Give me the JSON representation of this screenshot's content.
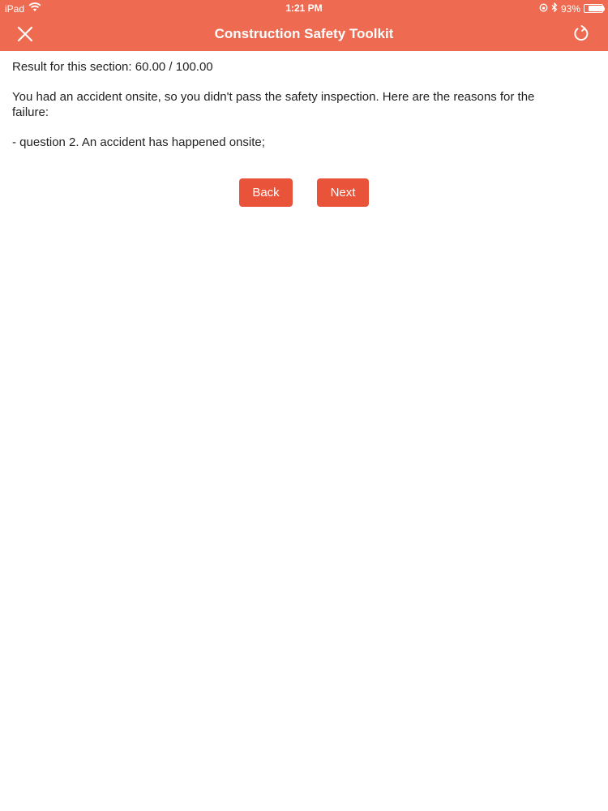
{
  "status_bar": {
    "device": "iPad",
    "time": "1:21 PM",
    "battery_percent": "93%",
    "battery_level": 0.93
  },
  "navbar": {
    "title": "Construction Safety Toolkit",
    "close_icon": "close-icon",
    "refresh_icon": "refresh-icon"
  },
  "content": {
    "result": "Result for this section: 60.00 / 100.00",
    "message": "You had an accident onsite, so you didn't pass the safety inspection. Here are the reasons for the failure:",
    "reasons": [
      "- question 2. An accident has happened onsite;"
    ]
  },
  "buttons": {
    "back_label": "Back",
    "next_label": "Next"
  },
  "colors": {
    "header": "#ee6a50",
    "button": "#e8533a"
  }
}
